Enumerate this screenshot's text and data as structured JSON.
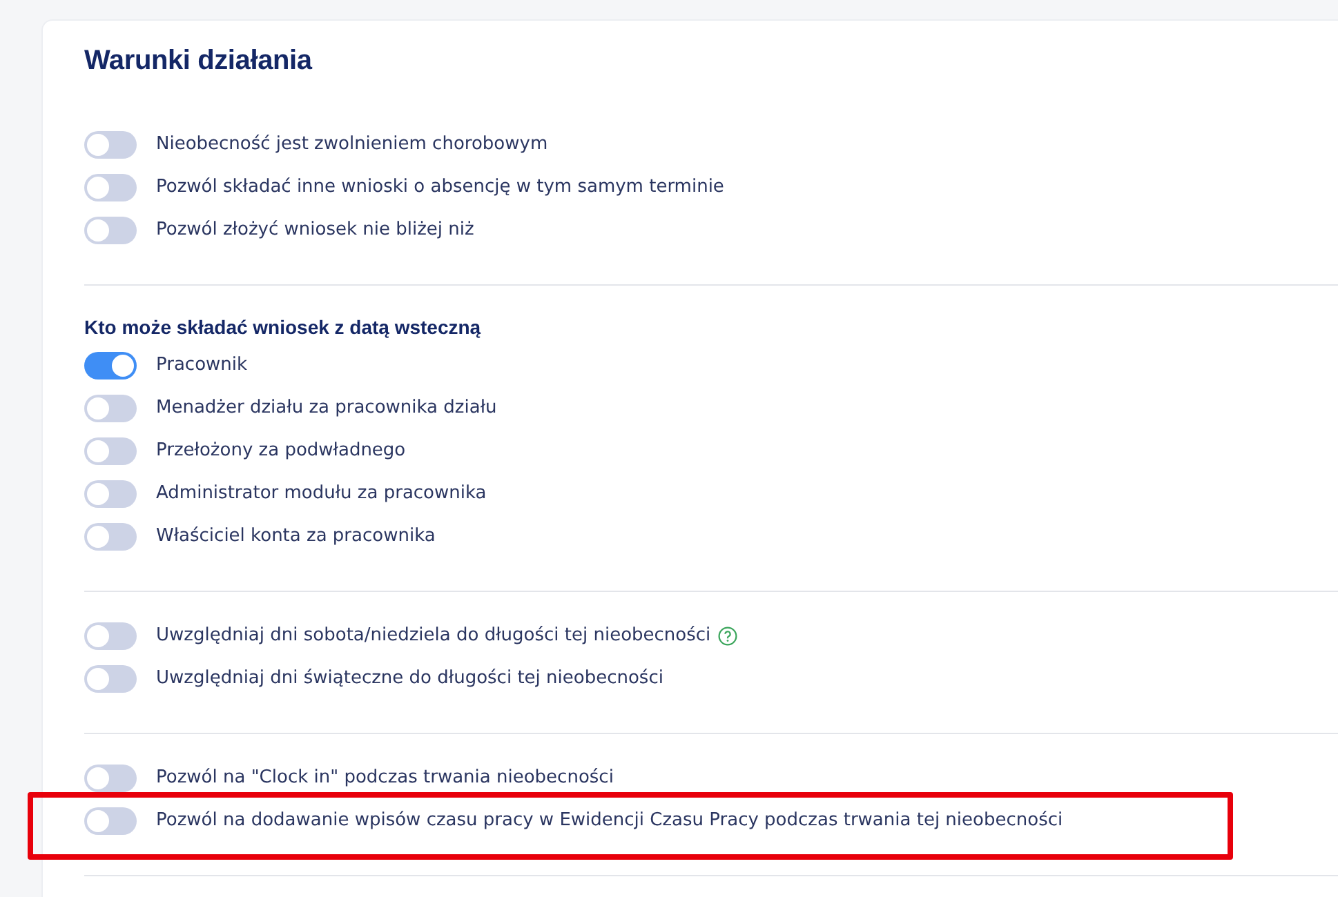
{
  "title": "Warunki działania",
  "sections": [
    {
      "items": [
        {
          "label": "Nieobecność jest zwolnieniem chorobowym",
          "on": false
        },
        {
          "label": "Pozwól składać inne wnioski o absencję w tym samym terminie",
          "on": false
        },
        {
          "label": "Pozwól złożyć wniosek nie bliżej niż",
          "on": false
        }
      ]
    },
    {
      "heading": "Kto może składać wniosek z datą wsteczną",
      "items": [
        {
          "label": "Pracownik",
          "on": true
        },
        {
          "label": "Menadżer działu za pracownika działu",
          "on": false
        },
        {
          "label": "Przełożony za podwładnego",
          "on": false
        },
        {
          "label": "Administrator modułu za pracownika",
          "on": false
        },
        {
          "label": "Właściciel konta za pracownika",
          "on": false
        }
      ]
    },
    {
      "items": [
        {
          "label": "Uwzględniaj dni sobota/niedziela do długości tej nieobecności",
          "on": false,
          "help": true
        },
        {
          "label": "Uwzględniaj dni świąteczne do długości tej nieobecności",
          "on": false
        }
      ]
    },
    {
      "items": [
        {
          "label": "Pozwól na \"Clock in\" podczas trwania nieobecności",
          "on": false
        },
        {
          "label": "Pozwól na dodawanie wpisów czasu pracy w Ewidencji Czasu Pracy podczas trwania tej nieobecności",
          "on": false,
          "highlighted": true
        }
      ]
    }
  ]
}
